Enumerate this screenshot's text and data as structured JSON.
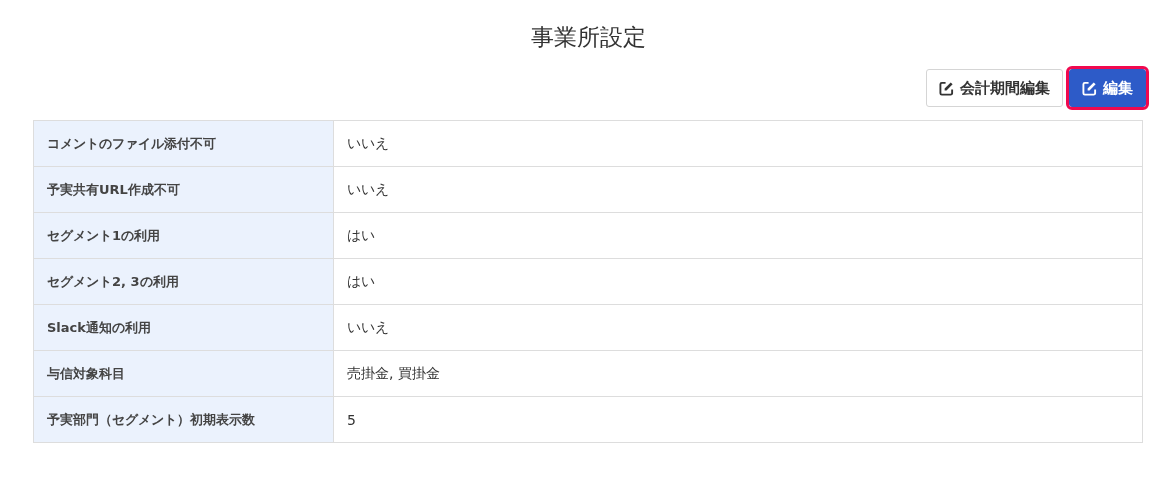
{
  "title": "事業所設定",
  "buttons": [
    {
      "label": "会計期間編集",
      "kind": "default",
      "focused": false
    },
    {
      "label": "編集",
      "kind": "primary",
      "focused": true
    }
  ],
  "rows": [
    {
      "label": "コメントのファイル添付不可",
      "value": "いいえ"
    },
    {
      "label": "予実共有URL作成不可",
      "value": "いいえ"
    },
    {
      "label": "セグメント1の利用",
      "value": "はい"
    },
    {
      "label": "セグメント2, 3の利用",
      "value": "はい"
    },
    {
      "label": "Slack通知の利用",
      "value": "いいえ"
    },
    {
      "label": "与信対象科目",
      "value": "売掛金, 買掛金"
    },
    {
      "label": "予実部門（セグメント）初期表示数",
      "value": "5"
    }
  ]
}
